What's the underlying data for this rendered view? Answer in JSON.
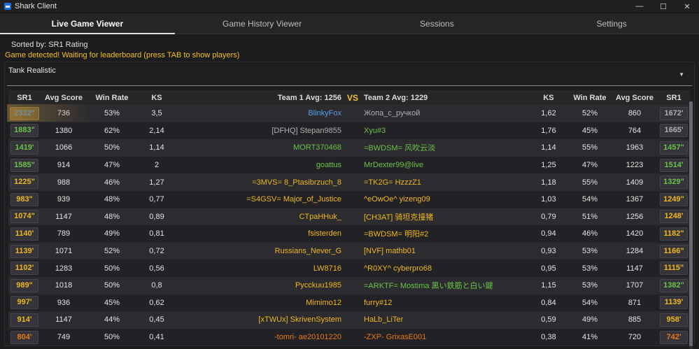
{
  "window": {
    "title": "Shark Client"
  },
  "tabs": [
    {
      "label": "Live Game Viewer",
      "active": true
    },
    {
      "label": "Game History Viewer",
      "active": false
    },
    {
      "label": "Sessions",
      "active": false
    },
    {
      "label": "Settings",
      "active": false
    }
  ],
  "status": {
    "sorted_by": "Sorted by: SR1 Rating",
    "detection": "Game detected! Waiting for leaderboard (press TAB to show players)"
  },
  "map": {
    "selected": "Tank Realistic"
  },
  "colors": {
    "blue": "#5aa0e8",
    "green": "#6cc24a",
    "gold": "#f0b81e",
    "orange": "#e8781c",
    "gray": "#b0b0b0",
    "yellow": "#f2c230"
  },
  "table": {
    "headers": {
      "sr1": "SR1",
      "avg_score": "Avg Score",
      "win_rate": "Win Rate",
      "ks": "KS",
      "team1": "Team 1  Avg: 1256",
      "vs": "VS",
      "team2": "Team 2  Avg: 1229"
    },
    "rows": [
      {
        "l_sr1": "2332\"",
        "l_sr1_c": "blue",
        "l_avg": "736",
        "l_win": "53%",
        "l_ks": "3,5",
        "p1": "BlinkyFox",
        "p1_c": "blue",
        "p2": "Жопа_с_ручкой",
        "p2_c": "gray",
        "r_ks": "1,62",
        "r_win": "52%",
        "r_avg": "860",
        "r_sr1": "1672'",
        "r_sr1_c": "gray"
      },
      {
        "l_sr1": "1883\"",
        "l_sr1_c": "green",
        "l_avg": "1380",
        "l_win": "62%",
        "l_ks": "2,14",
        "p1": "[DFHQ] Stepan9855",
        "p1_c": "gray",
        "p2": "Xyu#3",
        "p2_c": "green",
        "r_ks": "1,76",
        "r_win": "45%",
        "r_avg": "764",
        "r_sr1": "1665'",
        "r_sr1_c": "gray"
      },
      {
        "l_sr1": "1419'",
        "l_sr1_c": "green",
        "l_avg": "1066",
        "l_win": "50%",
        "l_ks": "1,14",
        "p1": "MORT370468",
        "p1_c": "green",
        "p2": "=BWDSM= 风吹云淡",
        "p2_c": "green",
        "r_ks": "1,14",
        "r_win": "55%",
        "r_avg": "1963",
        "r_sr1": "1457\"",
        "r_sr1_c": "green"
      },
      {
        "l_sr1": "1585\"",
        "l_sr1_c": "green",
        "l_avg": "914",
        "l_win": "47%",
        "l_ks": "2",
        "p1": "goattus",
        "p1_c": "green",
        "p2": "MrDexter99@live",
        "p2_c": "green",
        "r_ks": "1,25",
        "r_win": "47%",
        "r_avg": "1223",
        "r_sr1": "1514'",
        "r_sr1_c": "green"
      },
      {
        "l_sr1": "1225\"",
        "l_sr1_c": "gold",
        "l_avg": "988",
        "l_win": "46%",
        "l_ks": "1,27",
        "p1": "=3MVS= 8_Ptasibrzuch_8",
        "p1_c": "gold",
        "p2": "=TK2G= HzzzZ1",
        "p2_c": "gold",
        "r_ks": "1,18",
        "r_win": "55%",
        "r_avg": "1409",
        "r_sr1": "1329\"",
        "r_sr1_c": "green"
      },
      {
        "l_sr1": "983\"",
        "l_sr1_c": "gold",
        "l_avg": "939",
        "l_win": "48%",
        "l_ks": "0,77",
        "p1": "=S4GSV= Major_of_Justice",
        "p1_c": "gold",
        "p2": "^eOwOe^ yizeng09",
        "p2_c": "gold",
        "r_ks": "1,03",
        "r_win": "54%",
        "r_avg": "1367",
        "r_sr1": "1249\"",
        "r_sr1_c": "gold"
      },
      {
        "l_sr1": "1074\"",
        "l_sr1_c": "gold",
        "l_avg": "1147",
        "l_win": "48%",
        "l_ks": "0,89",
        "p1": "CTpaHHuk_",
        "p1_c": "gold",
        "p2": "[CH3AT] 骑坦克撞猪",
        "p2_c": "gold",
        "r_ks": "0,79",
        "r_win": "51%",
        "r_avg": "1256",
        "r_sr1": "1248'",
        "r_sr1_c": "gold"
      },
      {
        "l_sr1": "1140'",
        "l_sr1_c": "gold",
        "l_avg": "789",
        "l_win": "49%",
        "l_ks": "0,81",
        "p1": "fsisterden",
        "p1_c": "gold",
        "p2": "=BWDSM= 明阳#2",
        "p2_c": "gold",
        "r_ks": "0,94",
        "r_win": "46%",
        "r_avg": "1420",
        "r_sr1": "1182\"",
        "r_sr1_c": "gold"
      },
      {
        "l_sr1": "1139'",
        "l_sr1_c": "gold",
        "l_avg": "1071",
        "l_win": "52%",
        "l_ks": "0,72",
        "p1": "Russians_Never_G",
        "p1_c": "gold",
        "p2": "[NVF] mathb01",
        "p2_c": "gold",
        "r_ks": "0,93",
        "r_win": "53%",
        "r_avg": "1284",
        "r_sr1": "1166\"",
        "r_sr1_c": "gold"
      },
      {
        "l_sr1": "1102'",
        "l_sr1_c": "gold",
        "l_avg": "1283",
        "l_win": "50%",
        "l_ks": "0,56",
        "p1": "LW8716",
        "p1_c": "gold",
        "p2": "^R0XY^ cyberpro68",
        "p2_c": "gold",
        "r_ks": "0,95",
        "r_win": "53%",
        "r_avg": "1147",
        "r_sr1": "1115\"",
        "r_sr1_c": "gold"
      },
      {
        "l_sr1": "989\"",
        "l_sr1_c": "gold",
        "l_avg": "1018",
        "l_win": "50%",
        "l_ks": "0,8",
        "p1": "Pycckuu1985",
        "p1_c": "gold",
        "p2": "=ARKTF= Mostima 黒い鉄筋と白い鍵",
        "p2_c": "green",
        "r_ks": "1,15",
        "r_win": "53%",
        "r_avg": "1707",
        "r_sr1": "1382\"",
        "r_sr1_c": "green"
      },
      {
        "l_sr1": "997'",
        "l_sr1_c": "gold",
        "l_avg": "936",
        "l_win": "45%",
        "l_ks": "0,62",
        "p1": "Mimimo12",
        "p1_c": "gold",
        "p2": "furry#12",
        "p2_c": "gold",
        "r_ks": "0,84",
        "r_win": "54%",
        "r_avg": "871",
        "r_sr1": "1139'",
        "r_sr1_c": "gold"
      },
      {
        "l_sr1": "914'",
        "l_sr1_c": "gold",
        "l_avg": "1147",
        "l_win": "44%",
        "l_ks": "0,45",
        "p1": "[xTWUx] SkrivenSystem",
        "p1_c": "gold",
        "p2": "HaLb_LiTer",
        "p2_c": "gold",
        "r_ks": "0,59",
        "r_win": "49%",
        "r_avg": "885",
        "r_sr1": "958'",
        "r_sr1_c": "gold"
      },
      {
        "l_sr1": "804'",
        "l_sr1_c": "orange",
        "l_avg": "749",
        "l_win": "50%",
        "l_ks": "0,41",
        "p1": "-tomri- ae20101220",
        "p1_c": "orange",
        "p2": "-ZXP- GrixasE001",
        "p2_c": "orange",
        "r_ks": "0,38",
        "r_win": "41%",
        "r_avg": "720",
        "r_sr1": "742'",
        "r_sr1_c": "orange"
      }
    ]
  }
}
